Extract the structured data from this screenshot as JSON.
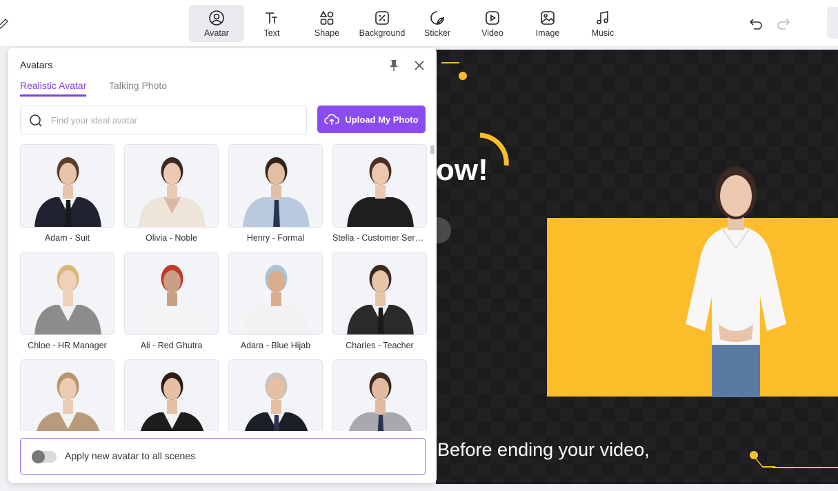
{
  "toolbar": {
    "tools": [
      {
        "label": "Avatar",
        "icon": "avatar-icon",
        "active": true
      },
      {
        "label": "Text",
        "icon": "text-icon",
        "active": false
      },
      {
        "label": "Shape",
        "icon": "shape-icon",
        "active": false
      },
      {
        "label": "Background",
        "icon": "background-icon",
        "active": false
      },
      {
        "label": "Sticker",
        "icon": "sticker-icon",
        "active": false
      },
      {
        "label": "Video",
        "icon": "video-icon",
        "active": false
      },
      {
        "label": "Image",
        "icon": "image-icon",
        "active": false
      },
      {
        "label": "Music",
        "icon": "music-icon",
        "active": false
      }
    ],
    "undo_icon": "undo-icon",
    "redo_icon": "redo-icon"
  },
  "panel": {
    "title": "Avatars",
    "tabs": [
      {
        "label": "Realistic Avatar",
        "active": true
      },
      {
        "label": "Talking Photo",
        "active": false
      }
    ],
    "search": {
      "placeholder": "Find your ideal avatar",
      "value": ""
    },
    "upload_label": "Upload My Photo",
    "avatars": [
      {
        "name": "Adam - Suit",
        "outfit": "#1f2230",
        "shirt": "#f5f5f5",
        "hair": "#5a3e28",
        "skin": "#e7c3a8",
        "tie": "#1a1a1a"
      },
      {
        "name": "Olivia - Noble",
        "outfit": "#ece5d8",
        "shirt": "#d9b8a6",
        "hair": "#3b2a22",
        "skin": "#ecc9b2",
        "tie": ""
      },
      {
        "name": "Henry - Formal",
        "outfit": "#b9c9de",
        "shirt": "#b9c9de",
        "hair": "#2f241c",
        "skin": "#e2bfa3",
        "tie": "#2a3350"
      },
      {
        "name": "Stella - Customer Service",
        "outfit": "#1e1e1e",
        "shirt": "#1e1e1e",
        "hair": "#4a3024",
        "skin": "#ecc8b0",
        "tie": ""
      },
      {
        "name": "Chloe - HR Manager",
        "outfit": "#8c8c8c",
        "shirt": "#efefef",
        "hair": "#d8b87a",
        "skin": "#efd0ba",
        "tie": ""
      },
      {
        "name": "Ali - Red Ghutra",
        "outfit": "#f4f4f4",
        "shirt": "#f4f4f4",
        "hair": "#c0392b",
        "skin": "#c9a085",
        "tie": ""
      },
      {
        "name": "Adara - Blue Hijab",
        "outfit": "#f2f2f2",
        "shirt": "#f2f2f2",
        "hair": "#a9c3d6",
        "skin": "#d9ad8e",
        "tie": ""
      },
      {
        "name": "Charles - Teacher",
        "outfit": "#2a2a2a",
        "shirt": "#efefef",
        "hair": "#3a2a20",
        "skin": "#e6c4a8",
        "tie": "#1a1a1a"
      },
      {
        "name": "",
        "outfit": "#b89b7a",
        "shirt": "#f2f2f2",
        "hair": "#b8956a",
        "skin": "#eccbb3",
        "tie": ""
      },
      {
        "name": "",
        "outfit": "#1d1d1d",
        "shirt": "#f2f2f2",
        "hair": "#2a1c16",
        "skin": "#e6c0a4",
        "tie": ""
      },
      {
        "name": "",
        "outfit": "#1d1f28",
        "shirt": "#f2f2f2",
        "hair": "#c9c3bb",
        "skin": "#e4bfa3",
        "tie": "#2a3350"
      },
      {
        "name": "",
        "outfit": "#a7a9ad",
        "shirt": "#a7a9ad",
        "hair": "#3a2c22",
        "skin": "#e0bb9f",
        "tie": "#2a3350"
      }
    ],
    "apply_all_label": "Apply new avatar to all scenes",
    "apply_all_enabled": false
  },
  "canvas": {
    "headline_visible": "ow!",
    "caption": "Before ending your video,",
    "accent_color": "#fbbd2a"
  },
  "colors": {
    "brand": "#8a4bf0",
    "tab_active": "#7b3fe4"
  }
}
